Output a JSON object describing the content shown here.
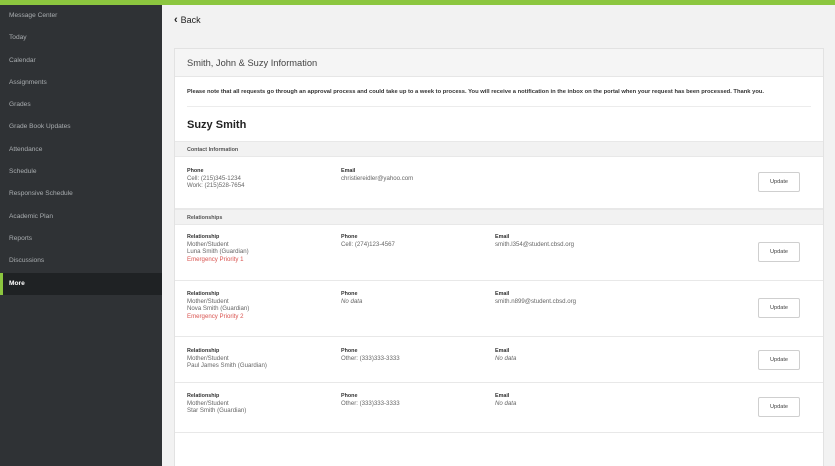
{
  "sidebar": {
    "items": [
      {
        "label": "Message Center"
      },
      {
        "label": "Today"
      },
      {
        "label": "Calendar"
      },
      {
        "label": "Assignments"
      },
      {
        "label": "Grades"
      },
      {
        "label": "Grade Book Updates"
      },
      {
        "label": "Attendance"
      },
      {
        "label": "Schedule"
      },
      {
        "label": "Responsive Schedule"
      },
      {
        "label": "Academic Plan"
      },
      {
        "label": "Reports"
      },
      {
        "label": "Discussions"
      },
      {
        "label": "More"
      }
    ],
    "active": "More"
  },
  "back_label": "Back",
  "card": {
    "title": "Smith, John & Suzy Information",
    "notice": "Please note that all requests go through an approval process and could take up to a week to process. You will receive a notification in the inbox on the portal when your request has been processed. Thank you.",
    "person_name": "Suzy Smith",
    "contact_section": "Contact Information",
    "contact": {
      "phone_label": "Phone",
      "phone_lines": [
        "Cell: (215)345-1234",
        "Work: (215)528-7654"
      ],
      "email_label": "Email",
      "email": "christiereidler@yahoo.com",
      "button": "Update"
    },
    "relationships_section": "Relationships",
    "relationships": [
      {
        "rel_label": "Relationship",
        "rel_type": "Mother/Student",
        "name": "Luna Smith (Guardian)",
        "priority": "Emergency Priority 1",
        "phone_label": "Phone",
        "phone": "Cell: (274)123-4567",
        "email_label": "Email",
        "email": "smith.l354@student.cbsd.org",
        "button": "Update"
      },
      {
        "rel_label": "Relationship",
        "rel_type": "Mother/Student",
        "name": "Nova Smith (Guardian)",
        "priority": "Emergency Priority 2",
        "phone_label": "Phone",
        "phone": "No data",
        "email_label": "Email",
        "email": "smith.n899@student.cbsd.org",
        "button": "Update"
      },
      {
        "rel_label": "Relationship",
        "rel_type": "Mother/Student",
        "name": "Paul James Smith (Guardian)",
        "priority": "",
        "phone_label": "Phone",
        "phone": "Other: (333)333-3333",
        "email_label": "Email",
        "email": "No data",
        "button": "Update"
      },
      {
        "rel_label": "Relationship",
        "rel_type": "Mother/Student",
        "name": "Star Smith (Guardian)",
        "priority": "",
        "phone_label": "Phone",
        "phone": "Other: (333)333-3333",
        "email_label": "Email",
        "email": "No data",
        "button": "Update"
      }
    ]
  },
  "colors": {
    "accent": "#8cc63f",
    "sidebar_bg": "#2f3235",
    "priority_red": "#d9534f"
  }
}
